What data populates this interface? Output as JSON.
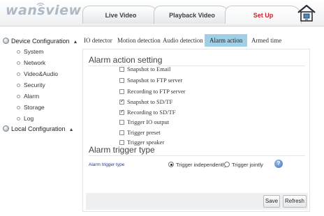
{
  "header": {
    "logo_text": "wansview",
    "nav_tabs": [
      {
        "label": "Live Video"
      },
      {
        "label": "Playback Video"
      },
      {
        "label": "Set Up",
        "active": true
      }
    ],
    "active_tab_color": "#cc1f2b"
  },
  "sidebar": {
    "groups": [
      {
        "label": "Device Configuration",
        "expanded": true,
        "items": [
          "System",
          "Network",
          "Video&Audio",
          "Security",
          "Alarm",
          "Storage",
          "Log"
        ]
      },
      {
        "label": "Local Configuration",
        "expanded": true,
        "items": []
      }
    ]
  },
  "subtabs": [
    {
      "label": "IO detector"
    },
    {
      "label": "Motion detection"
    },
    {
      "label": "Audio detection"
    },
    {
      "label": "Alarm action",
      "active": true
    },
    {
      "label": "Armed time"
    }
  ],
  "alarm_action": {
    "title": "Alarm action setting",
    "options": [
      {
        "label": "Snapshot to Email",
        "checked": false
      },
      {
        "label": "Snapshot to FTP server",
        "checked": false
      },
      {
        "label": "Recording to FTP server",
        "checked": false
      },
      {
        "label": "Snapshot to SD/TF",
        "checked": true
      },
      {
        "label": "Recording to SD/TF",
        "checked": true
      },
      {
        "label": "Trigger IO output",
        "checked": false
      },
      {
        "label": "Trigger preset",
        "checked": false
      },
      {
        "label": "Trigger speaker",
        "checked": false
      }
    ]
  },
  "alarm_trigger": {
    "title": "Alarm trigger type",
    "field_label": "Alarm trigger type",
    "options": [
      {
        "label": "Trigger independently",
        "selected": true
      },
      {
        "label": "Trigger jointly",
        "selected": false
      }
    ],
    "help_icon": "help-icon"
  },
  "buttons": {
    "save": "Save",
    "refresh": "Refresh"
  },
  "colors": {
    "active_subtab": "#9fd0e8",
    "link_label": "#1e3c8a"
  }
}
